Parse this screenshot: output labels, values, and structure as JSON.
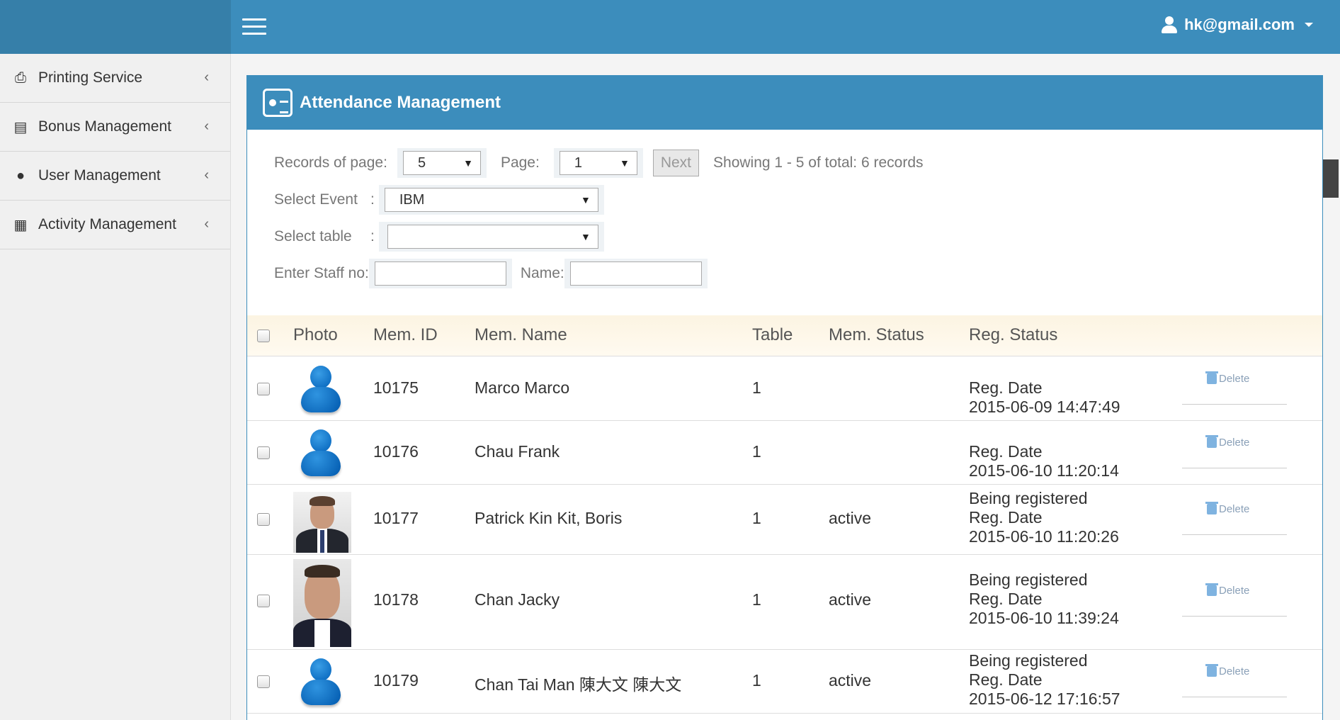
{
  "header": {
    "user_email": "hk@gmail.com"
  },
  "sidebar": {
    "items": [
      {
        "label": "Printing Service",
        "icon": "printer-icon"
      },
      {
        "label": "Bonus Management",
        "icon": "gift-icon"
      },
      {
        "label": "User Management",
        "icon": "user-icon"
      },
      {
        "label": "Activity Management",
        "icon": "bank-icon"
      }
    ]
  },
  "box": {
    "title": "Attendance Management"
  },
  "filters": {
    "records_label": "Records of page:",
    "records_value": "5",
    "page_label": "Page:",
    "page_value": "1",
    "next_label": "Next",
    "showing_text": "Showing 1 - 5 of total: 6 records",
    "event_label": "Select Event",
    "event_colon": ":",
    "event_value": "IBM",
    "table_label": "Select table",
    "table_colon": ":",
    "table_value": "",
    "staff_label": "Enter Staff no:",
    "staff_value": "",
    "name_label": "Name:",
    "name_value": ""
  },
  "table": {
    "headers": {
      "photo": "Photo",
      "mem_id": "Mem. ID",
      "mem_name": "Mem. Name",
      "table": "Table",
      "mem_status": "Mem. Status",
      "reg_status": "Reg. Status"
    },
    "delete_label": "Delete",
    "rows": [
      {
        "photo": "generic-avatar",
        "mem_id": "10175",
        "mem_name": "Marco Marco",
        "table": "1",
        "mem_status": "",
        "reg_line1": "",
        "reg_line2": "Reg. Date",
        "reg_line3": "2015-06-09 14:47:49"
      },
      {
        "photo": "generic-avatar",
        "mem_id": "10176",
        "mem_name": "Chau Frank",
        "table": "1",
        "mem_status": "",
        "reg_line1": "",
        "reg_line2": "Reg. Date",
        "reg_line3": "2015-06-10 11:20:14"
      },
      {
        "photo": "portrait",
        "mem_id": "10177",
        "mem_name": "Patrick Kin Kit, Boris",
        "table": "1",
        "mem_status": "active",
        "reg_line1": "Being registered",
        "reg_line2": "Reg. Date",
        "reg_line3": "2015-06-10 11:20:26"
      },
      {
        "photo": "portrait",
        "mem_id": "10178",
        "mem_name": "Chan Jacky",
        "table": "1",
        "mem_status": "active",
        "reg_line1": "Being registered",
        "reg_line2": "Reg. Date",
        "reg_line3": "2015-06-10 11:39:24"
      },
      {
        "photo": "generic-avatar",
        "mem_id": "10179",
        "mem_name": "Chan Tai Man 陳大文 陳大文",
        "table": "1",
        "mem_status": "active",
        "reg_line1": "Being registered",
        "reg_line2": "Reg. Date",
        "reg_line3": "2015-06-12 17:16:57"
      }
    ]
  }
}
